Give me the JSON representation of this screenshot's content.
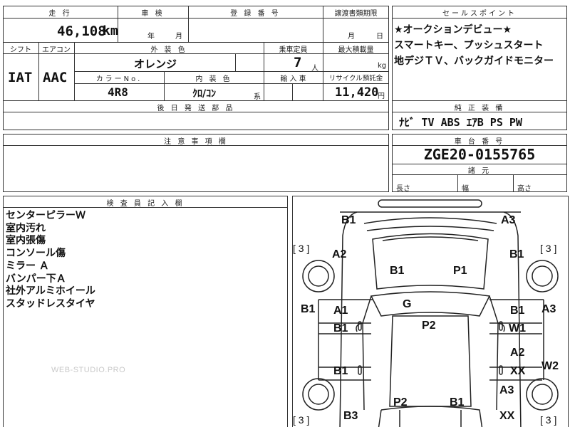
{
  "header": {
    "mileage_label": "走 行",
    "mileage_value": "46,108",
    "mileage_unit": "km",
    "inspection_label": "車 検",
    "inspection_year": "年",
    "inspection_month": "月",
    "registration_label": "登 録 番 号",
    "transfer_label": "譲渡書類期限",
    "transfer_month": "月",
    "transfer_day": "日"
  },
  "sales": {
    "title": "セールスポイント",
    "lines": [
      "★オークションデビュー★",
      "スマートキー、プッシュスタート",
      "地デジＴＶ、バックガイドモニター"
    ]
  },
  "specs": {
    "shift_label": "シフト",
    "shift_value": "IAT",
    "aircon_label": "エアコン",
    "aircon_value": "AAC",
    "ext_color_label": "外 装 色",
    "ext_color_value": "オレンジ",
    "capacity_label": "乗車定員",
    "capacity_value": "7",
    "capacity_unit": "人",
    "load_label": "最大積載量",
    "load_unit": "kg",
    "color_no_label": "カラーNo.",
    "color_no_value": "4R8",
    "int_color_label": "内 装 色",
    "int_color_value": "ｸﾛ/ｺﾝ",
    "int_color_suffix": "系",
    "import_label": "輸 入 車",
    "recycle_label": "リサイクル預託金",
    "recycle_value": "11,420",
    "recycle_unit": "円",
    "parts_label": "後 日 発 送 部 品"
  },
  "equipment": {
    "title": "純 正 装 備",
    "value": "ﾅﾋﾞ  TV  ABS  ｴｱB  PS  PW"
  },
  "caution": {
    "title": "注 意 事 項 欄"
  },
  "chassis": {
    "title": "車 台 番 号",
    "value": "ZGE20-0155765",
    "dims_title": "諸 元",
    "length_label": "長さ",
    "width_label": "幅",
    "height_label": "高さ"
  },
  "inspector": {
    "title": "検 査 員 記 入 欄",
    "notes": [
      "センターピラーＷ",
      "室内汚れ",
      "室内張傷",
      "コンソール傷",
      "ミラー Ａ",
      "バンパー下Ａ",
      "社外アルミホイール",
      "スタッドレスタイヤ"
    ]
  },
  "diagram": {
    "marks": {
      "front_left": "B1",
      "front_right": "A3",
      "fender_left": "A2",
      "fender_right": "B1",
      "hood_left": "B1",
      "hood_right": "P1",
      "glass": "G",
      "pillar_left": "B1",
      "pillar_right": "A3",
      "front_door_left_1": "A1",
      "front_door_left_2": "B1",
      "front_door_right_1": "B1",
      "front_door_right_2": "W1",
      "roof": "P2",
      "rear_door_left": "B1",
      "rear_door_right_1": "A2",
      "rear_door_right_2": "XX",
      "quarter_right": "W2",
      "trunk_left": "P2",
      "trunk_right": "B1",
      "rear_left": "B3",
      "rear_right_1": "A3",
      "rear_right_2": "XX",
      "tire_front_left": "[ 3 ]",
      "tire_front_right": "[ 3 ]",
      "tire_rear_left": "[ 3 ]",
      "tire_rear_right": "[ 3 ]"
    }
  },
  "watermark": "WEB-STUDIO.PRO"
}
